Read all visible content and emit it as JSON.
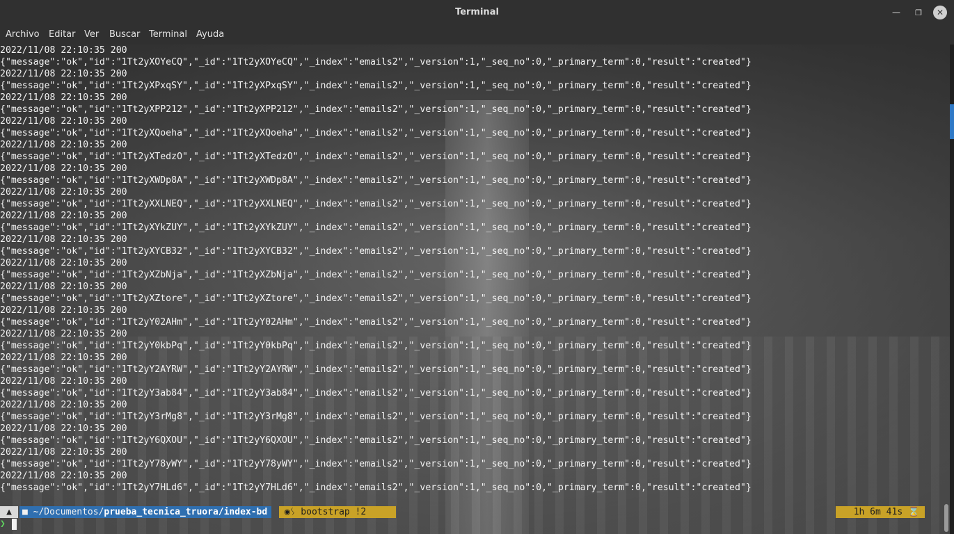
{
  "window": {
    "title": "Terminal"
  },
  "menu": [
    "Archivo",
    "Editar",
    "Ver",
    "Buscar",
    "Terminal",
    "Ayuda"
  ],
  "log_lines": [
    "2022/11/08 22:10:35 200",
    "{\"message\":\"ok\",\"id\":\"1Tt2yXOYeCQ\",\"_id\":\"1Tt2yXOYeCQ\",\"_index\":\"emails2\",\"_version\":1,\"_seq_no\":0,\"_primary_term\":0,\"result\":\"created\"}",
    "2022/11/08 22:10:35 200",
    "{\"message\":\"ok\",\"id\":\"1Tt2yXPxqSY\",\"_id\":\"1Tt2yXPxqSY\",\"_index\":\"emails2\",\"_version\":1,\"_seq_no\":0,\"_primary_term\":0,\"result\":\"created\"}",
    "2022/11/08 22:10:35 200",
    "{\"message\":\"ok\",\"id\":\"1Tt2yXPP212\",\"_id\":\"1Tt2yXPP212\",\"_index\":\"emails2\",\"_version\":1,\"_seq_no\":0,\"_primary_term\":0,\"result\":\"created\"}",
    "2022/11/08 22:10:35 200",
    "{\"message\":\"ok\",\"id\":\"1Tt2yXQoeha\",\"_id\":\"1Tt2yXQoeha\",\"_index\":\"emails2\",\"_version\":1,\"_seq_no\":0,\"_primary_term\":0,\"result\":\"created\"}",
    "2022/11/08 22:10:35 200",
    "{\"message\":\"ok\",\"id\":\"1Tt2yXTedzO\",\"_id\":\"1Tt2yXTedzO\",\"_index\":\"emails2\",\"_version\":1,\"_seq_no\":0,\"_primary_term\":0,\"result\":\"created\"}",
    "2022/11/08 22:10:35 200",
    "{\"message\":\"ok\",\"id\":\"1Tt2yXWDp8A\",\"_id\":\"1Tt2yXWDp8A\",\"_index\":\"emails2\",\"_version\":1,\"_seq_no\":0,\"_primary_term\":0,\"result\":\"created\"}",
    "2022/11/08 22:10:35 200",
    "{\"message\":\"ok\",\"id\":\"1Tt2yXXLNEQ\",\"_id\":\"1Tt2yXXLNEQ\",\"_index\":\"emails2\",\"_version\":1,\"_seq_no\":0,\"_primary_term\":0,\"result\":\"created\"}",
    "2022/11/08 22:10:35 200",
    "{\"message\":\"ok\",\"id\":\"1Tt2yXYkZUY\",\"_id\":\"1Tt2yXYkZUY\",\"_index\":\"emails2\",\"_version\":1,\"_seq_no\":0,\"_primary_term\":0,\"result\":\"created\"}",
    "2022/11/08 22:10:35 200",
    "{\"message\":\"ok\",\"id\":\"1Tt2yXYCB32\",\"_id\":\"1Tt2yXYCB32\",\"_index\":\"emails2\",\"_version\":1,\"_seq_no\":0,\"_primary_term\":0,\"result\":\"created\"}",
    "2022/11/08 22:10:35 200",
    "{\"message\":\"ok\",\"id\":\"1Tt2yXZbNja\",\"_id\":\"1Tt2yXZbNja\",\"_index\":\"emails2\",\"_version\":1,\"_seq_no\":0,\"_primary_term\":0,\"result\":\"created\"}",
    "2022/11/08 22:10:35 200",
    "{\"message\":\"ok\",\"id\":\"1Tt2yXZtore\",\"_id\":\"1Tt2yXZtore\",\"_index\":\"emails2\",\"_version\":1,\"_seq_no\":0,\"_primary_term\":0,\"result\":\"created\"}",
    "2022/11/08 22:10:35 200",
    "{\"message\":\"ok\",\"id\":\"1Tt2yY02AHm\",\"_id\":\"1Tt2yY02AHm\",\"_index\":\"emails2\",\"_version\":1,\"_seq_no\":0,\"_primary_term\":0,\"result\":\"created\"}",
    "2022/11/08 22:10:35 200",
    "{\"message\":\"ok\",\"id\":\"1Tt2yY0kbPq\",\"_id\":\"1Tt2yY0kbPq\",\"_index\":\"emails2\",\"_version\":1,\"_seq_no\":0,\"_primary_term\":0,\"result\":\"created\"}",
    "2022/11/08 22:10:35 200",
    "{\"message\":\"ok\",\"id\":\"1Tt2yY2AYRW\",\"_id\":\"1Tt2yY2AYRW\",\"_index\":\"emails2\",\"_version\":1,\"_seq_no\":0,\"_primary_term\":0,\"result\":\"created\"}",
    "2022/11/08 22:10:35 200",
    "{\"message\":\"ok\",\"id\":\"1Tt2yY3ab84\",\"_id\":\"1Tt2yY3ab84\",\"_index\":\"emails2\",\"_version\":1,\"_seq_no\":0,\"_primary_term\":0,\"result\":\"created\"}",
    "2022/11/08 22:10:35 200",
    "{\"message\":\"ok\",\"id\":\"1Tt2yY3rMg8\",\"_id\":\"1Tt2yY3rMg8\",\"_index\":\"emails2\",\"_version\":1,\"_seq_no\":0,\"_primary_term\":0,\"result\":\"created\"}",
    "2022/11/08 22:10:35 200",
    "{\"message\":\"ok\",\"id\":\"1Tt2yY6QXOU\",\"_id\":\"1Tt2yY6QXOU\",\"_index\":\"emails2\",\"_version\":1,\"_seq_no\":0,\"_primary_term\":0,\"result\":\"created\"}",
    "2022/11/08 22:10:35 200",
    "{\"message\":\"ok\",\"id\":\"1Tt2yY78yWY\",\"_id\":\"1Tt2yY78yWY\",\"_index\":\"emails2\",\"_version\":1,\"_seq_no\":0,\"_primary_term\":0,\"result\":\"created\"}",
    "2022/11/08 22:10:35 200",
    "{\"message\":\"ok\",\"id\":\"1Tt2yY7HLd6\",\"_id\":\"1Tt2yY7HLd6\",\"_index\":\"emails2\",\"_version\":1,\"_seq_no\":0,\"_primary_term\":0,\"result\":\"created\"}"
  ],
  "prompt": {
    "os_icon": "linux-icon",
    "dir_icon": "folder-icon",
    "dir_prefix": "~/Documentos/",
    "dir_bold": "prueba_tecnica_truora/index-bd",
    "git_icon": "github-icon",
    "git_branch_icon": "git-branch-icon",
    "git_text": " bootstrap !2",
    "duration": "1h 6m 41s",
    "duration_icon": "hourglass-icon",
    "symbol": "❯"
  },
  "colors": {
    "dir_segment": "#2f6fb0",
    "git_segment": "#c9a227",
    "prompt_symbol": "#5fd35f",
    "scroll_thumb": "#2f79c6"
  }
}
